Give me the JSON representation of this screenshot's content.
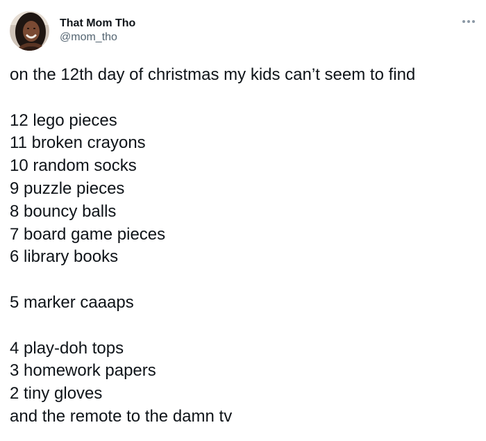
{
  "author": {
    "display_name": "That Mom Tho",
    "handle": "@mom_tho",
    "avatar_icon": "profile-photo"
  },
  "menu_icon": "more-options-icon",
  "tweet": {
    "intro": "on the 12th day of christmas my kids can’t seem to find",
    "group1": [
      "12 lego pieces",
      "11 broken crayons",
      "10 random socks",
      "9 puzzle pieces",
      "8 bouncy balls",
      "7 board game pieces",
      "6 library books"
    ],
    "group2": [
      "5 marker caaaps"
    ],
    "group3": [
      "4 play-doh tops",
      "3 homework papers",
      "2 tiny gloves",
      "and the remote to the damn tv"
    ]
  },
  "colors": {
    "text": "#0f1419",
    "secondary": "#536471"
  }
}
